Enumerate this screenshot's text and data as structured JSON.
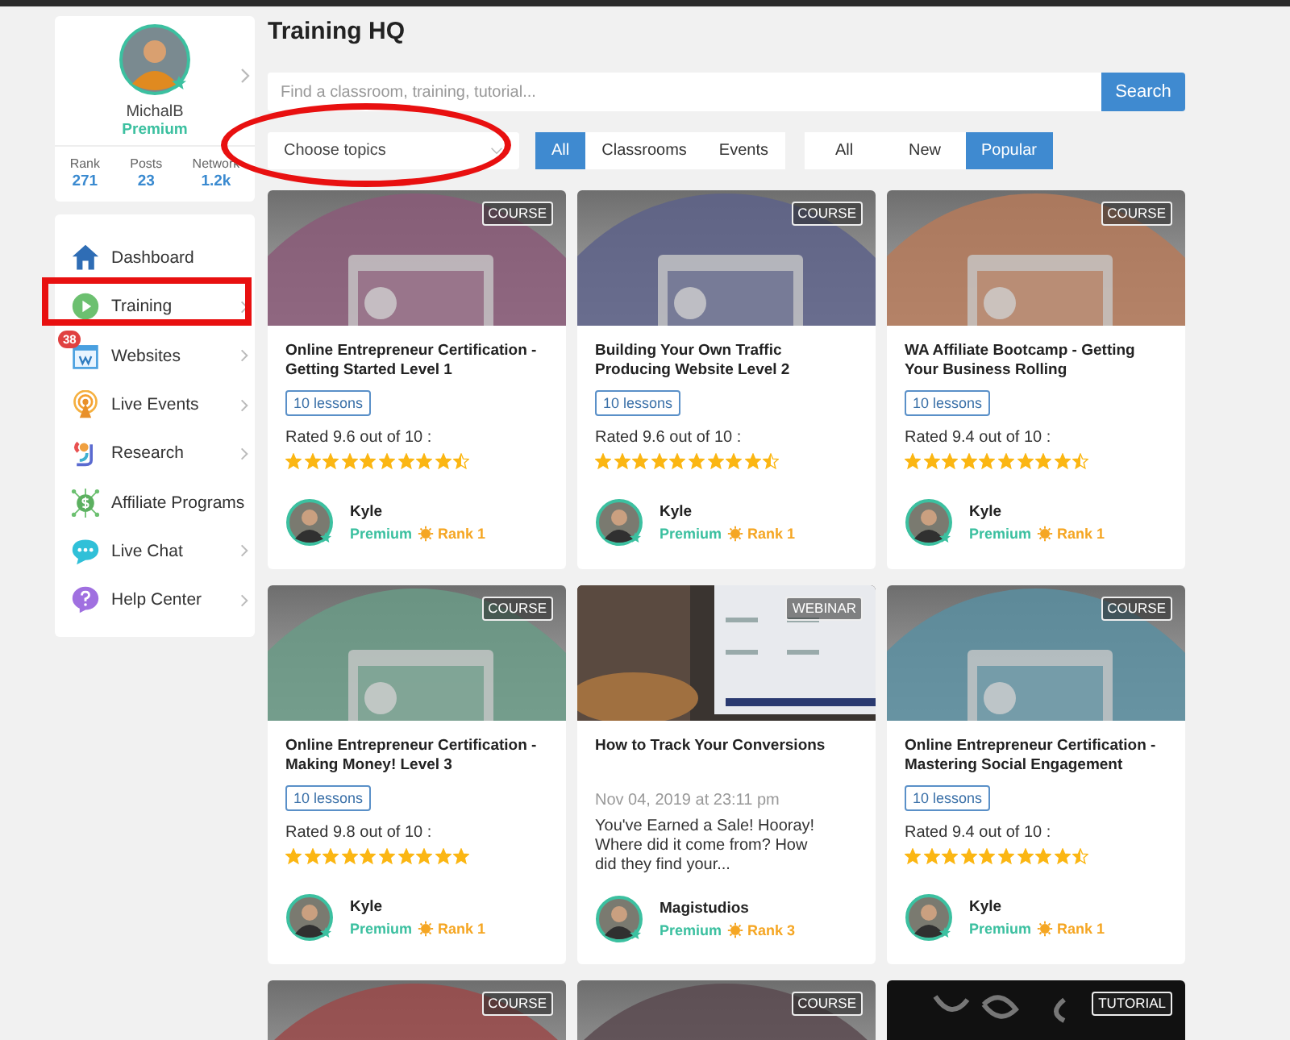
{
  "profile": {
    "username": "MichalB",
    "membership": "Premium",
    "stats": [
      {
        "label": "Rank",
        "value": "271"
      },
      {
        "label": "Posts",
        "value": "23"
      },
      {
        "label": "Network",
        "value": "1.2k"
      }
    ]
  },
  "nav": [
    {
      "kind": "home",
      "label": "Dashboard",
      "chevron": false
    },
    {
      "kind": "play",
      "label": "Training",
      "chevron": true
    },
    {
      "kind": "website",
      "label": "Websites",
      "chevron": true,
      "badge": "38"
    },
    {
      "kind": "broadcast",
      "label": "Live Events",
      "chevron": true
    },
    {
      "kind": "research",
      "label": "Research",
      "chevron": true
    },
    {
      "kind": "affiliate",
      "label": "Affiliate Programs",
      "chevron": false
    },
    {
      "kind": "chat",
      "label": "Live Chat",
      "chevron": true
    },
    {
      "kind": "help",
      "label": "Help Center",
      "chevron": true
    }
  ],
  "page_title": "Training HQ",
  "search": {
    "placeholder": "Find a classroom, training, tutorial...",
    "button": "Search"
  },
  "topic_select": {
    "value": "Choose topics"
  },
  "type_filters": [
    {
      "label": "All",
      "selected": true
    },
    {
      "label": "Classrooms",
      "selected": false
    },
    {
      "label": "Events",
      "selected": false
    }
  ],
  "sort_filters": [
    {
      "label": "All",
      "selected": false
    },
    {
      "label": "New",
      "selected": false
    },
    {
      "label": "Popular",
      "selected": true
    }
  ],
  "cards": [
    {
      "kind": "course",
      "badge": "COURSE",
      "title": "Online Entrepreneur Certification - Getting Started Level 1",
      "lessons": "10 lessons",
      "rating": "Rated 9.6 out of 10 :",
      "stars": 9.5,
      "author": {
        "name": "Kyle",
        "membership": "Premium",
        "rank": "Rank 1"
      }
    },
    {
      "kind": "course",
      "badge": "COURSE",
      "title": "Building Your Own Traffic Producing Website Level 2",
      "lessons": "10 lessons",
      "rating": "Rated 9.6 out of 10 :",
      "stars": 9.5,
      "author": {
        "name": "Kyle",
        "membership": "Premium",
        "rank": "Rank 1"
      }
    },
    {
      "kind": "course",
      "badge": "COURSE",
      "title": "WA Affiliate Bootcamp - Getting Your Business Rolling",
      "lessons": "10 lessons",
      "rating": "Rated 9.4 out of 10 :",
      "stars": 9.5,
      "author": {
        "name": "Kyle",
        "membership": "Premium",
        "rank": "Rank 1"
      }
    },
    {
      "kind": "course",
      "badge": "COURSE",
      "title": "Online Entrepreneur Certification - Making Money! Level 3",
      "lessons": "10 lessons",
      "rating": "Rated 9.8 out of 10 :",
      "stars": 10,
      "author": {
        "name": "Kyle",
        "membership": "Premium",
        "rank": "Rank 1"
      }
    },
    {
      "kind": "webinar",
      "badge": "WEBINAR",
      "title": "How to Track Your Conversions",
      "date": "Nov 04, 2019 at 23:11 pm",
      "excerpt": "You've Earned a Sale! Hooray! Where did it come from? How did they find your...",
      "author": {
        "name": "Magistudios",
        "membership": "Premium",
        "rank": "Rank 3"
      }
    },
    {
      "kind": "course",
      "badge": "COURSE",
      "title": "Online Entrepreneur Certification - Mastering Social Engagement",
      "lessons": "10 lessons",
      "rating": "Rated 9.4 out of 10 :",
      "stars": 9.5,
      "author": {
        "name": "Kyle",
        "membership": "Premium",
        "rank": "Rank 1"
      }
    },
    {
      "kind": "course",
      "badge": "COURSE"
    },
    {
      "kind": "course",
      "badge": "COURSE"
    },
    {
      "kind": "tutorial",
      "badge": "TUTORIAL"
    }
  ],
  "annotations": [
    {
      "kind": "oval"
    },
    {
      "kind": "rectangle"
    }
  ]
}
